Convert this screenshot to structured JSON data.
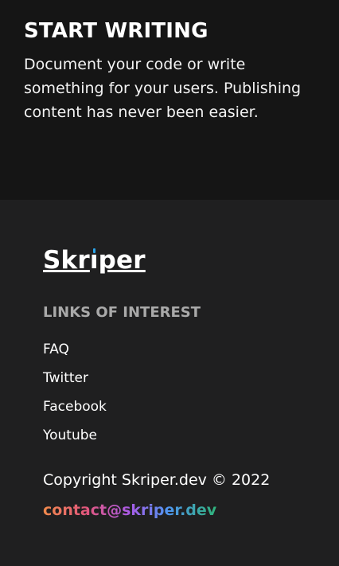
{
  "hero": {
    "title": "START WRITING",
    "text": "Document your code or write something for your users. Publishing content has never been easier."
  },
  "footer": {
    "logo": {
      "before_i": "Skr",
      "i": "ı",
      "after_i": "per",
      "dot_color": "#2aa4ea"
    },
    "links_heading": "LINKS OF INTEREST",
    "links": [
      {
        "label": "FAQ"
      },
      {
        "label": "Twitter"
      },
      {
        "label": "Facebook"
      },
      {
        "label": "Youtube"
      }
    ],
    "copyright": "Copyright Skriper.dev © 2022",
    "contact_email": "contact@skriper.dev"
  },
  "colors": {
    "hero_background": "#151515",
    "footer_background": "#1f1f20",
    "heading_muted": "#a9a9a9",
    "contact_gradient": [
      "#f08a4b",
      "#e2567c",
      "#a95be8",
      "#4f95f0",
      "#2fb37a"
    ]
  }
}
